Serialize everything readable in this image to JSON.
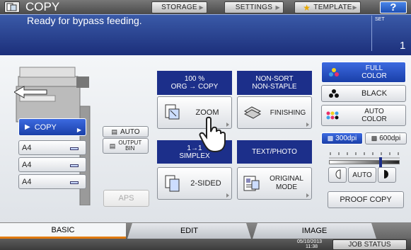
{
  "header": {
    "title": "COPY",
    "storage": "STORAGE",
    "settings": "SETTINGS",
    "template": "TEMPLATE",
    "help": "?"
  },
  "status": {
    "message": "Ready for bypass feeding.",
    "set_label": "SET",
    "set_value": "1"
  },
  "paper": {
    "copy_label": "COPY",
    "trays": [
      "A4",
      "A4",
      "A4"
    ],
    "aps": "APS",
    "auto": "AUTO",
    "output_bin": "OUTPUT\nBIN"
  },
  "zoom": {
    "header": "100 %\nORG  →  COPY",
    "label": "ZOOM"
  },
  "finishing": {
    "header": "NON-SORT\nNON-STAPLE",
    "label": "FINISHING"
  },
  "sided": {
    "header": "1→1\nSIMPLEX",
    "label": "2-SIDED"
  },
  "original": {
    "header": "TEXT/PHOTO",
    "label": "ORIGINAL\nMODE"
  },
  "color": {
    "full": "FULL\nCOLOR",
    "black": "BLACK",
    "auto": "AUTO\nCOLOR"
  },
  "resolution": {
    "r300": "300dpi",
    "r600": "600dpi"
  },
  "density": {
    "auto": "AUTO",
    "level": 0.72
  },
  "proof": "PROOF COPY",
  "tabs": [
    "BASIC",
    "EDIT",
    "IMAGE"
  ],
  "footer": {
    "date": "05/10/2013",
    "time": "11:38",
    "job_status": "JOB STATUS"
  }
}
